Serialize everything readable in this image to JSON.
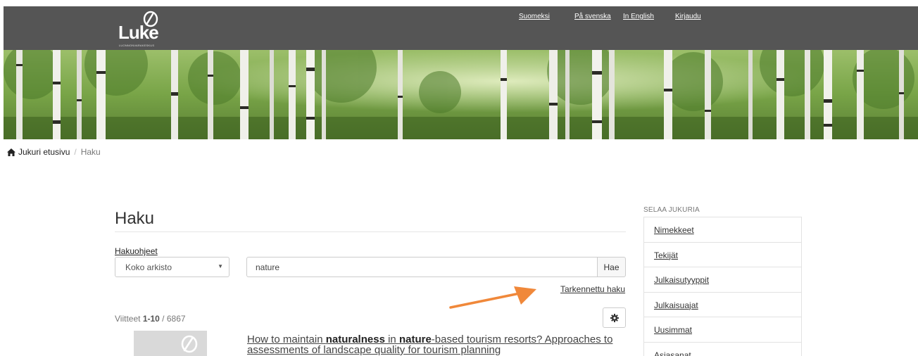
{
  "header": {
    "logo_text": "Luke",
    "logo_subtitle": "LUONNONVARAKESKUS",
    "links": [
      {
        "id": "fi",
        "label": "Suomeksi"
      },
      {
        "id": "sv",
        "label": "På svenska"
      },
      {
        "id": "en",
        "label": "In English"
      },
      {
        "id": "login",
        "label": "Kirjaudu"
      }
    ]
  },
  "breadcrumb": {
    "home_label": "Jukuri etusivu",
    "current_label": "Haku"
  },
  "main": {
    "title": "Haku",
    "help_link": "Hakuohjeet",
    "scope_select_value": "Koko arkisto",
    "search_value": "nature",
    "search_button": "Hae",
    "advanced_search_link": "Tarkennettu haku",
    "results_count": {
      "prefix": "Viitteet ",
      "range": "1-10",
      "separator": " / ",
      "total": "6867"
    },
    "first_result": {
      "t1": "How to maintain ",
      "t2": "naturalness",
      "t3": " in ",
      "t4": "nature",
      "t5": "-based tourism resorts? Approaches to assessments of landscape quality for tourism planning"
    }
  },
  "sidebar": {
    "heading": "SELAA JUKURIA",
    "items": [
      {
        "label": "Nimekkeet"
      },
      {
        "label": "Tekijät"
      },
      {
        "label": "Julkaisutyyppit"
      },
      {
        "label": "Julkaisuajat"
      },
      {
        "label": "Uusimmat"
      },
      {
        "label": "Asiasanat"
      }
    ]
  },
  "colors": {
    "header_bg": "#555555",
    "annotation_arrow": "#f0883a",
    "banner_foliage": "#6a9140"
  }
}
